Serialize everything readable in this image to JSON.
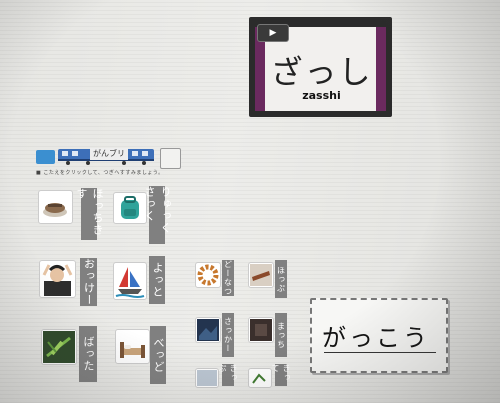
{
  "word_card": {
    "play_icon": "▶",
    "kana": "ざっし",
    "romaji": "zasshi",
    "stripe_color": "#6b2a5f"
  },
  "header": {
    "train_label": "がんブリ",
    "instruction": "■ こたえをクリックして、つぎへすすみましょう。"
  },
  "vocab": [
    {
      "label": "ほっちきす",
      "image": "stapler"
    },
    {
      "label": "りゅっくさっく",
      "image": "backpack"
    },
    {
      "label": "おっけー",
      "image": "ok-gesture"
    },
    {
      "label": "よっと",
      "image": "yacht"
    },
    {
      "label": "ばった",
      "image": "grasshopper"
    },
    {
      "label": "べっど",
      "image": "bed"
    },
    {
      "label": "どーなつ",
      "image": "donut"
    },
    {
      "label": "ほっぷ",
      "image": "log"
    },
    {
      "label": "さっかー",
      "image": "night-scene"
    },
    {
      "label": "まっち",
      "image": "dark-photo"
    },
    {
      "label": "きっぷ",
      "image": "small-photo"
    },
    {
      "label": "きって",
      "image": "plant-photo"
    }
  ],
  "handwriting": {
    "text": "がっこう"
  },
  "colors": {
    "label_bg": "#808080",
    "blue_button": "#3b8fd0"
  }
}
